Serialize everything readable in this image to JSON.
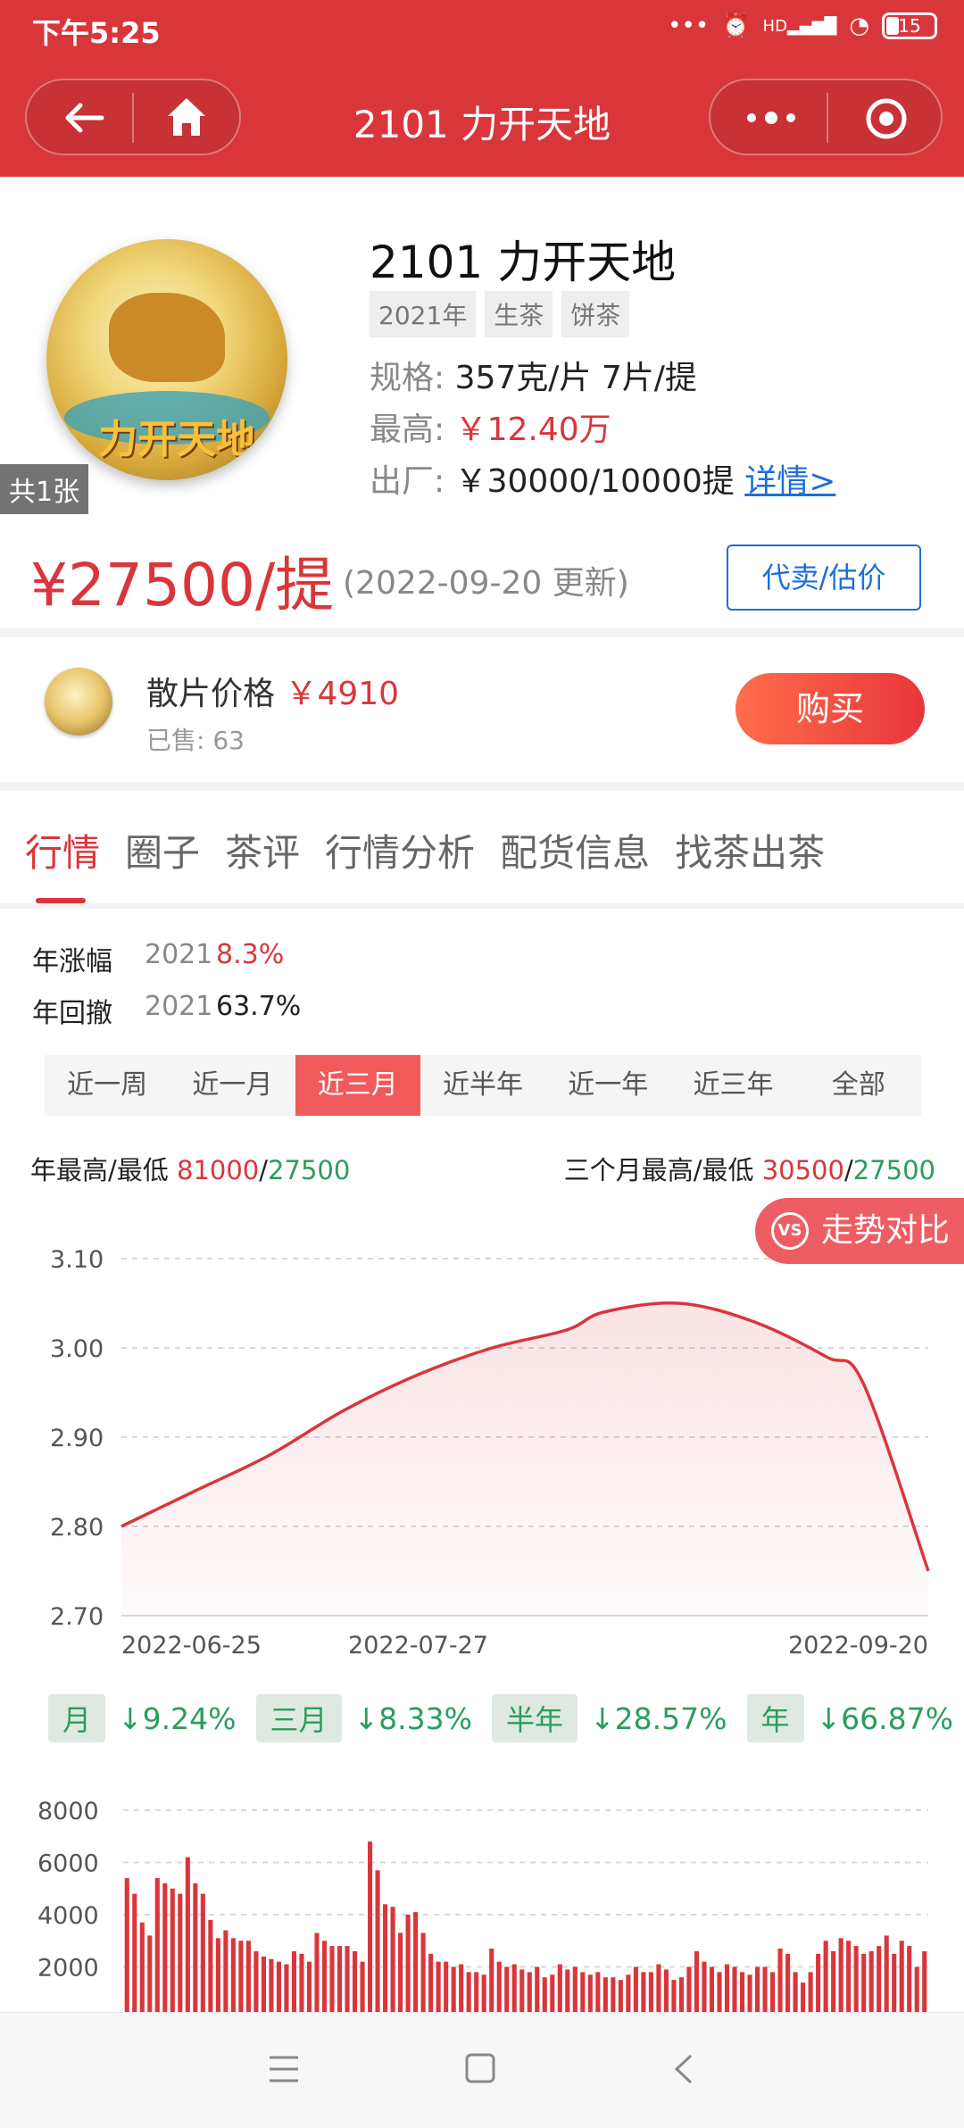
{
  "status": {
    "time": "下午5:25",
    "signal_label": "HD",
    "battery": "15"
  },
  "nav": {
    "title": "2101 力开天地"
  },
  "product": {
    "image_count": "共1张",
    "cake_text": "力开天地",
    "title": "2101 力开天地",
    "tags": [
      "2021年",
      "生茶",
      "饼茶"
    ],
    "spec_label": "规格:",
    "spec_value": "357克/片 7片/提",
    "max_label": "最高:",
    "max_value": "￥12.40万",
    "factory_label": "出厂:",
    "factory_value": "￥30000/10000提",
    "detail_link": "详情>",
    "price": "¥27500/提",
    "update": "(2022-09-20 更新)",
    "consign_button": "代卖/估价"
  },
  "loose": {
    "title": "散片价格",
    "price": "￥4910",
    "sold": "已售: 63",
    "buy_button": "购买"
  },
  "tabs": [
    "行情",
    "圈子",
    "茶评",
    "行情分析",
    "配货信息",
    "找茶出茶"
  ],
  "stats": {
    "rise_label": "年涨幅",
    "rise_year": "2021",
    "rise_value": "8.3%",
    "drawdown_label": "年回撤",
    "drawdown_year": "2021",
    "drawdown_value": "63.7%"
  },
  "ranges": [
    "近一周",
    "近一月",
    "近三月",
    "近半年",
    "近一年",
    "近三年",
    "全部"
  ],
  "active_range": 2,
  "highlow": {
    "year_label": "年最高/最低",
    "year_high": "81000",
    "year_low": "27500",
    "q_label": "三个月最高/最低",
    "q_high": "30500",
    "q_low": "27500",
    "slash": "/"
  },
  "vs_button": {
    "icon": "VS",
    "label": "走势对比"
  },
  "changes": [
    {
      "label": "月",
      "value": "↓9.24%"
    },
    {
      "label": "三月",
      "value": "↓8.33%"
    },
    {
      "label": "半年",
      "value": "↓28.57%"
    },
    {
      "label": "年",
      "value": "↓66.87%"
    }
  ],
  "colors": {
    "brand_red": "#d9363b",
    "down_green": "#2a9d5c",
    "link_blue": "#1d6fd8"
  },
  "chart_data": [
    {
      "type": "area",
      "ylim": [
        2.7,
        3.1
      ],
      "yticks": [
        "3.10",
        "3.00",
        "2.90",
        "2.80",
        "2.70"
      ],
      "x_tick_labels": [
        "2022-06-25",
        "2022-07-27",
        "2022-09-20"
      ],
      "x": [
        "2022-06-25",
        "2022-07-03",
        "2022-07-11",
        "2022-07-19",
        "2022-07-27",
        "2022-08-04",
        "2022-08-12",
        "2022-08-16",
        "2022-08-24",
        "2022-09-01",
        "2022-09-09",
        "2022-09-13",
        "2022-09-20"
      ],
      "values": [
        2.8,
        2.84,
        2.88,
        2.93,
        2.97,
        3.0,
        3.02,
        3.04,
        3.05,
        3.03,
        2.99,
        2.96,
        2.75
      ],
      "grid": true,
      "color": "#d9363b"
    },
    {
      "type": "bar",
      "ylim": [
        0,
        8000
      ],
      "yticks": [
        "8000",
        "6000",
        "4000",
        "2000"
      ],
      "values": [
        5400,
        4800,
        3700,
        3200,
        5400,
        5200,
        5000,
        4800,
        6200,
        5200,
        4800,
        3800,
        3100,
        3400,
        3100,
        3000,
        3000,
        2600,
        2400,
        2300,
        2200,
        2100,
        2600,
        2500,
        2200,
        3300,
        3000,
        2800,
        2800,
        2800,
        2600,
        2200,
        6800,
        5700,
        4400,
        4300,
        3300,
        4000,
        4100,
        3300,
        2500,
        2200,
        2200,
        2000,
        2100,
        1800,
        1800,
        1700,
        2700,
        2200,
        2000,
        2100,
        1900,
        1800,
        2000,
        1600,
        1700,
        2100,
        1900,
        2000,
        1800,
        1700,
        1800,
        1600,
        1600,
        1500,
        1700,
        2000,
        1800,
        1800,
        2100,
        1900,
        1500,
        1600,
        2000,
        2600,
        2200,
        2000,
        1800,
        2100,
        2000,
        1800,
        1700,
        2000,
        2000,
        1800,
        2700,
        2500,
        1800,
        1400,
        1800,
        2500,
        3000,
        2600,
        3100,
        3000,
        2800,
        2500,
        2600,
        2800,
        3200,
        2500,
        3000,
        2800,
        2000,
        2600
      ],
      "grid": true,
      "color": "#d9363b"
    }
  ]
}
